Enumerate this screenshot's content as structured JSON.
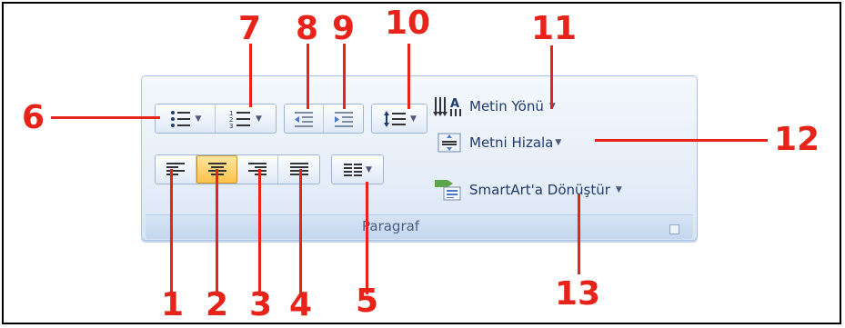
{
  "group": {
    "label": "Paragraf"
  },
  "commands": {
    "text_direction": "Metin Yönü",
    "align_text": "Metni Hizala",
    "smartart": "SmartArt'a Dönüştür"
  },
  "callouts": [
    "1",
    "2",
    "3",
    "4",
    "5",
    "6",
    "7",
    "8",
    "9",
    "10",
    "11",
    "12",
    "13"
  ],
  "colors": {
    "callout": "#e8231a",
    "accent": "#ffc24a",
    "ribbon": "#dfe9f6"
  }
}
